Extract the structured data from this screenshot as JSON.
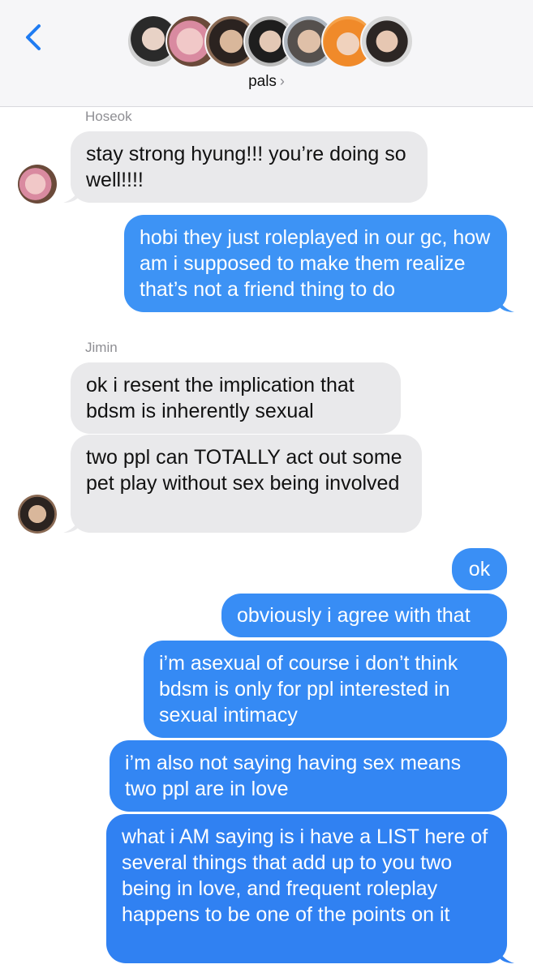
{
  "header": {
    "group_name": "pals",
    "chevron": "›",
    "avatar_count": 7
  },
  "colors": {
    "accent": "#1f7cf2",
    "incoming_bubble": "#e9e9eb",
    "outgoing_bubble": "#2f86f3"
  },
  "thread": {
    "sender_hoseok": "Hoseok",
    "sender_jimin": "Jimin",
    "messages": [
      {
        "from": "Hoseok",
        "text": "stay strong hyung!!! you’re doing so well!!!!"
      },
      {
        "from": "me",
        "text": "hobi they just roleplayed in our gc, how am i supposed to make them realize that’s not a friend thing to do"
      },
      {
        "from": "Jimin",
        "text": "ok i resent the implication that bdsm is inherently sexual"
      },
      {
        "from": "Jimin",
        "text": "two ppl can TOTALLY act out some pet play without sex being involved"
      },
      {
        "from": "me",
        "text": "ok"
      },
      {
        "from": "me",
        "text": "obviously i agree with that"
      },
      {
        "from": "me",
        "text": "i’m asexual of course i don’t think bdsm is only for ppl interested in sexual intimacy"
      },
      {
        "from": "me",
        "text": "i’m also not saying having sex means two ppl are in love"
      },
      {
        "from": "me",
        "text": "what i AM saying is i have a LIST here of several things that add up to you two being in love, and frequent roleplay happens to be one of the points on it"
      }
    ]
  }
}
